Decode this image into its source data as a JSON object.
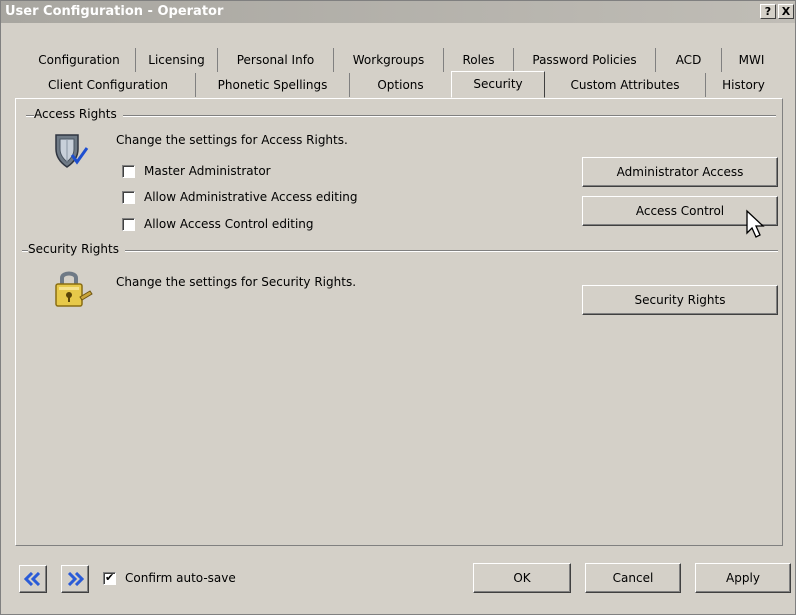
{
  "window": {
    "title": "User Configuration - Operator",
    "help_label": "?",
    "close_label": "X"
  },
  "tabs": {
    "row1": [
      "Configuration",
      "Licensing",
      "Personal Info",
      "Workgroups",
      "Roles",
      "Password Policies",
      "ACD",
      "MWI"
    ],
    "row2": [
      "Client Configuration",
      "Phonetic Spellings",
      "Options",
      "Security",
      "Custom Attributes",
      "History"
    ],
    "active": "Security"
  },
  "access_rights": {
    "group_label": "Access Rights",
    "description": "Change the settings for Access Rights.",
    "checkboxes": [
      {
        "label": "Master Administrator",
        "checked": false
      },
      {
        "label": "Allow Administrative Access editing",
        "checked": false
      },
      {
        "label": "Allow Access Control editing",
        "checked": false
      }
    ],
    "buttons": [
      "Administrator Access",
      "Access Control"
    ]
  },
  "security_rights": {
    "group_label": "Security Rights",
    "description": "Change the settings for Security Rights.",
    "button": "Security Rights"
  },
  "footer": {
    "confirm_label": "Confirm auto-save",
    "confirm_checked": true,
    "ok_label": "OK",
    "cancel_label": "Cancel",
    "apply_label": "Apply"
  },
  "icons": {
    "prev": "double-chevron-left-icon",
    "next": "double-chevron-right-icon",
    "access_rights": "shield-check-icon",
    "security_rights": "padlock-icon",
    "cursor": "mouse-pointer-icon"
  },
  "colors": {
    "dialog_bg": "#d4d0c8",
    "titlebar": "#a8a6a0",
    "nav_arrow": "#2a5bd7"
  }
}
